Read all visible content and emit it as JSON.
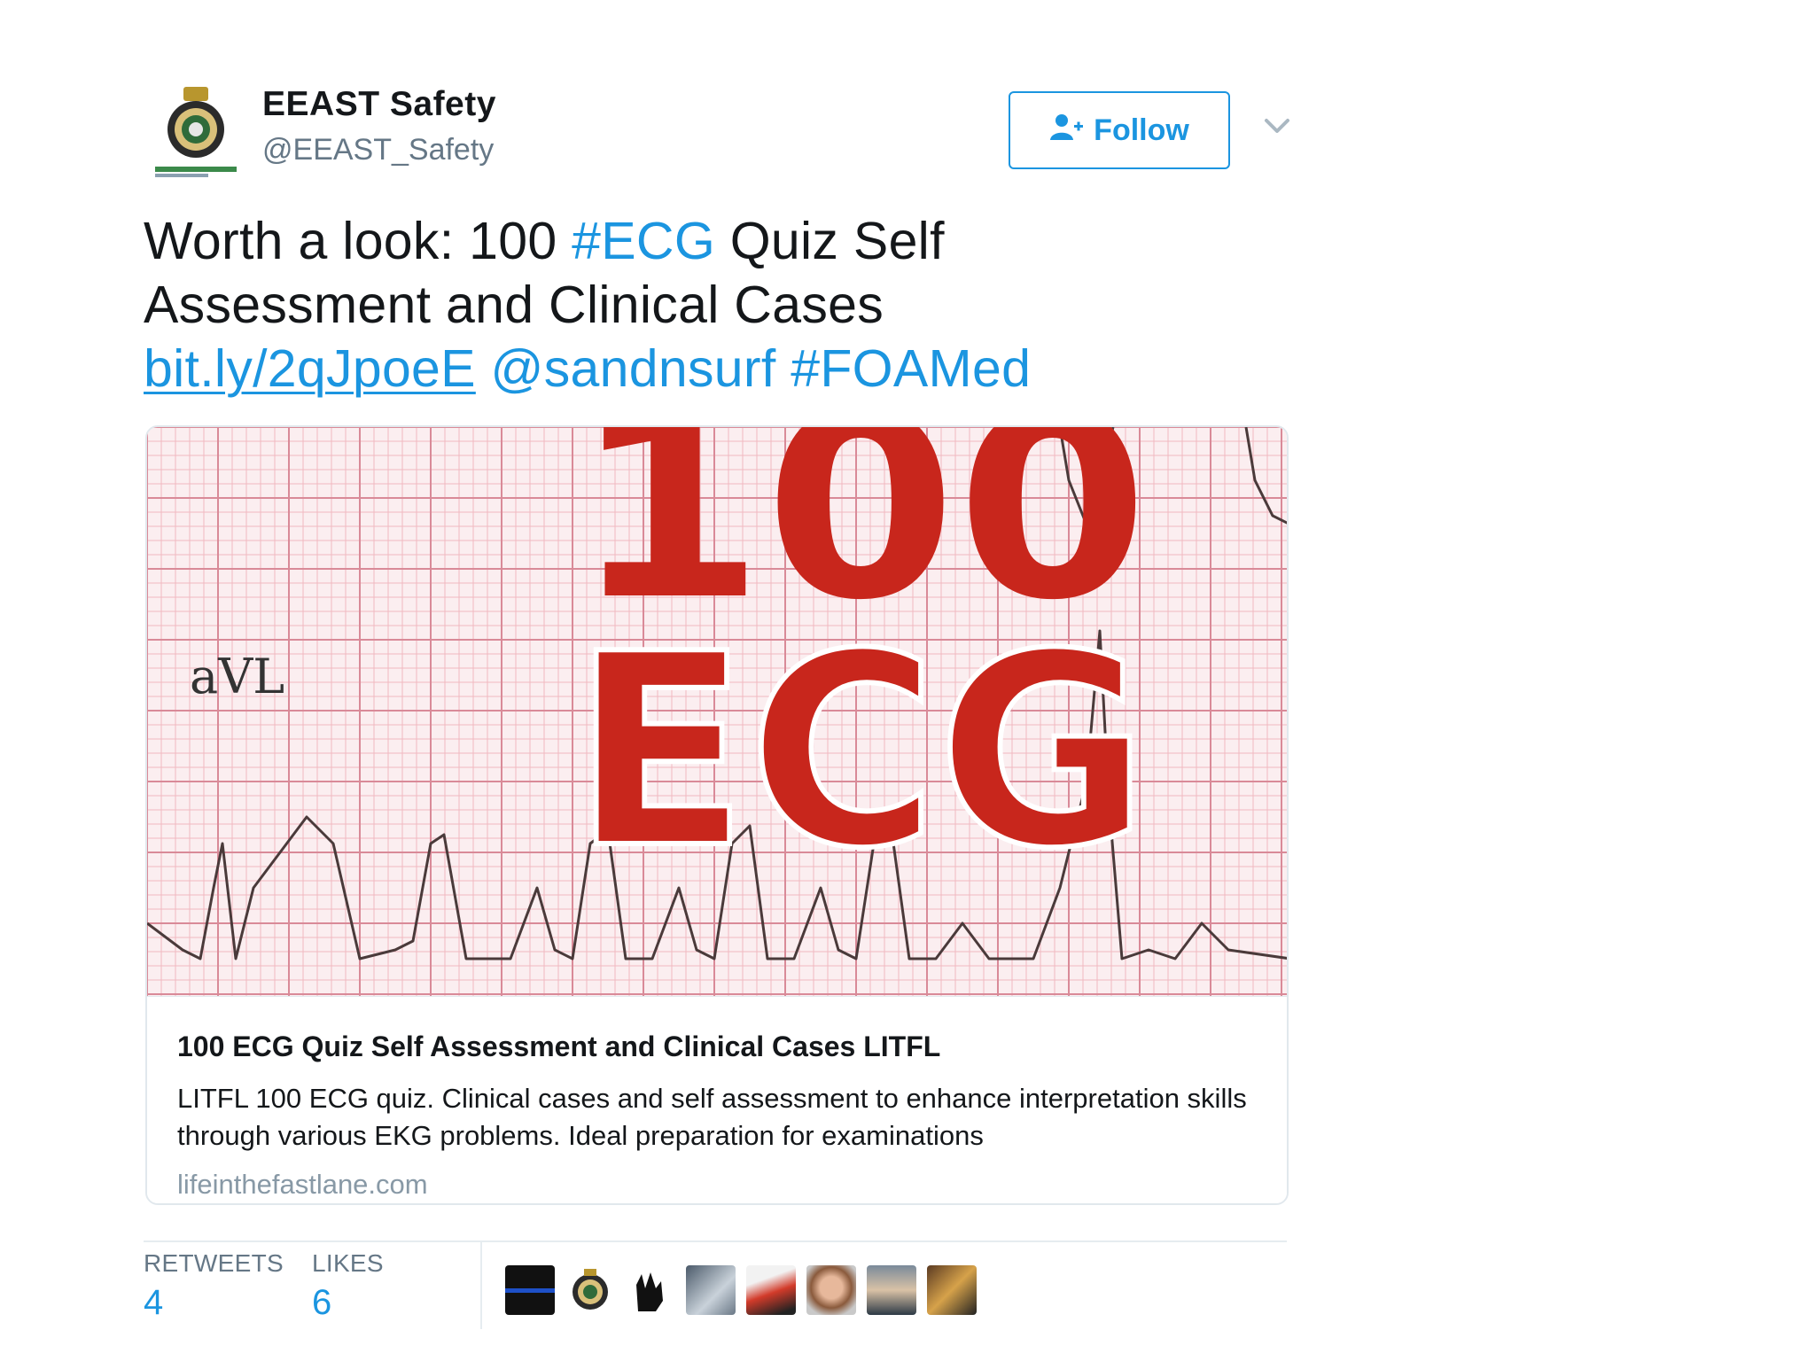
{
  "tweet": {
    "author": {
      "name": "EEAST Safety",
      "handle": "@EEAST_Safety"
    },
    "follow_label": "Follow",
    "text": {
      "t1": "Worth a look: 100 ",
      "tag1": "#ECG",
      "t2": " Quiz Self Assessment and Clinical Cases",
      "link": "bit.ly/2qJpoeE",
      "mention": "@sandnsurf",
      "tag2": "#FOAMed"
    },
    "card": {
      "image": {
        "label_big1": "100",
        "label_big2": "ECG",
        "lead": "aVL"
      },
      "title": "100 ECG Quiz Self Assessment and Clinical Cases LITFL",
      "description": "LITFL 100 ECG quiz. Clinical cases and self assessment to enhance interpretation skills through various EKG problems. Ideal preparation for examinations",
      "domain": "lifeinthefastlane.com"
    },
    "stats": {
      "retweets_label": "RETWEETS",
      "retweets": "4",
      "likes_label": "LIKES",
      "likes": "6"
    },
    "likers": [
      {
        "name": "liker-avatar-1"
      },
      {
        "name": "liker-avatar-2"
      },
      {
        "name": "liker-avatar-3"
      },
      {
        "name": "liker-avatar-4"
      },
      {
        "name": "liker-avatar-5"
      },
      {
        "name": "liker-avatar-6"
      },
      {
        "name": "liker-avatar-7"
      },
      {
        "name": "liker-avatar-8"
      }
    ]
  },
  "colors": {
    "accent": "#1b95e0",
    "ecg_red": "#c8261c",
    "grid_pink": "#f0b8c0"
  },
  "icons": {
    "follow": "person-add-icon",
    "caret": "chevron-down-icon"
  }
}
